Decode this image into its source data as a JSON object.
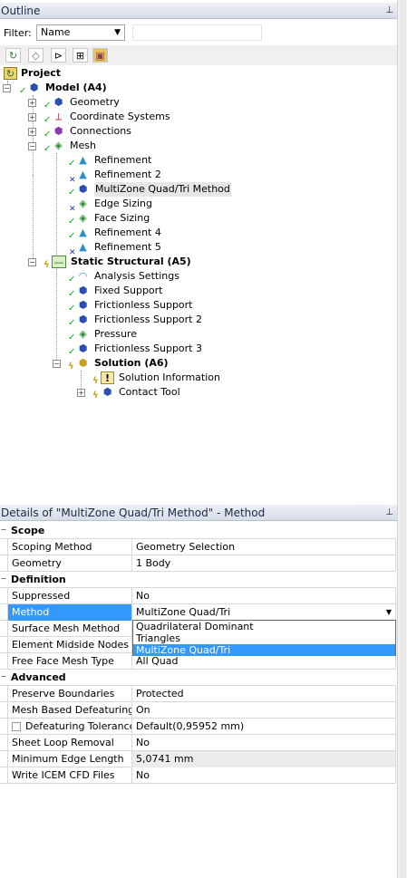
{
  "outline": {
    "title": "Outline",
    "pin_icon": "pin-icon"
  },
  "filter": {
    "label": "Filter:",
    "value": "Name",
    "search_value": ""
  },
  "tree": [
    {
      "label": "Project",
      "bold": true
    },
    {
      "label": "Model (A4)",
      "bold": true
    },
    {
      "label": "Geometry"
    },
    {
      "label": "Coordinate Systems"
    },
    {
      "label": "Connections"
    },
    {
      "label": "Mesh"
    },
    {
      "label": "Refinement"
    },
    {
      "label": "Refinement 2"
    },
    {
      "label": "MultiZone Quad/Tri Method"
    },
    {
      "label": "Edge Sizing"
    },
    {
      "label": "Face Sizing"
    },
    {
      "label": "Refinement 4"
    },
    {
      "label": "Refinement 5"
    },
    {
      "label": "Static Structural (A5)",
      "bold": true
    },
    {
      "label": "Analysis Settings"
    },
    {
      "label": "Fixed Support"
    },
    {
      "label": "Frictionless Support"
    },
    {
      "label": "Frictionless Support 2"
    },
    {
      "label": "Pressure"
    },
    {
      "label": "Frictionless Support 3"
    },
    {
      "label": "Solution (A6)",
      "bold": true
    },
    {
      "label": "Solution Information"
    },
    {
      "label": "Contact Tool"
    }
  ],
  "details": {
    "title": "Details of \"MultiZone Quad/Tri Method\" - Method",
    "sections": {
      "scope": "Scope",
      "definition": "Definition",
      "advanced": "Advanced"
    },
    "rows": {
      "scoping_method": {
        "label": "Scoping Method",
        "value": "Geometry Selection"
      },
      "geometry": {
        "label": "Geometry",
        "value": "1 Body"
      },
      "suppressed": {
        "label": "Suppressed",
        "value": "No"
      },
      "method": {
        "label": "Method",
        "value": "MultiZone Quad/Tri"
      },
      "surface_mesh_method": {
        "label": "Surface Mesh Method",
        "value": ""
      },
      "element_midside_nodes": {
        "label": "Element Midside Nodes",
        "value": ""
      },
      "free_face_mesh_type": {
        "label": "Free Face Mesh Type",
        "value": "All Quad"
      },
      "preserve_boundaries": {
        "label": "Preserve Boundaries",
        "value": "Protected"
      },
      "mesh_based_defeaturing": {
        "label": "Mesh Based Defeaturing",
        "value": "On"
      },
      "defeaturing_tolerance": {
        "label": "Defeaturing Tolerance",
        "value": "Default(0,95952 mm)"
      },
      "sheet_loop_removal": {
        "label": "Sheet Loop Removal",
        "value": "No"
      },
      "minimum_edge_length": {
        "label": "Minimum Edge Length",
        "value": "5,0741 mm"
      },
      "write_icem": {
        "label": "Write ICEM CFD Files",
        "value": "No"
      }
    },
    "method_options": [
      "Quadrilateral Dominant",
      "Triangles",
      "MultiZone Quad/Tri"
    ]
  }
}
